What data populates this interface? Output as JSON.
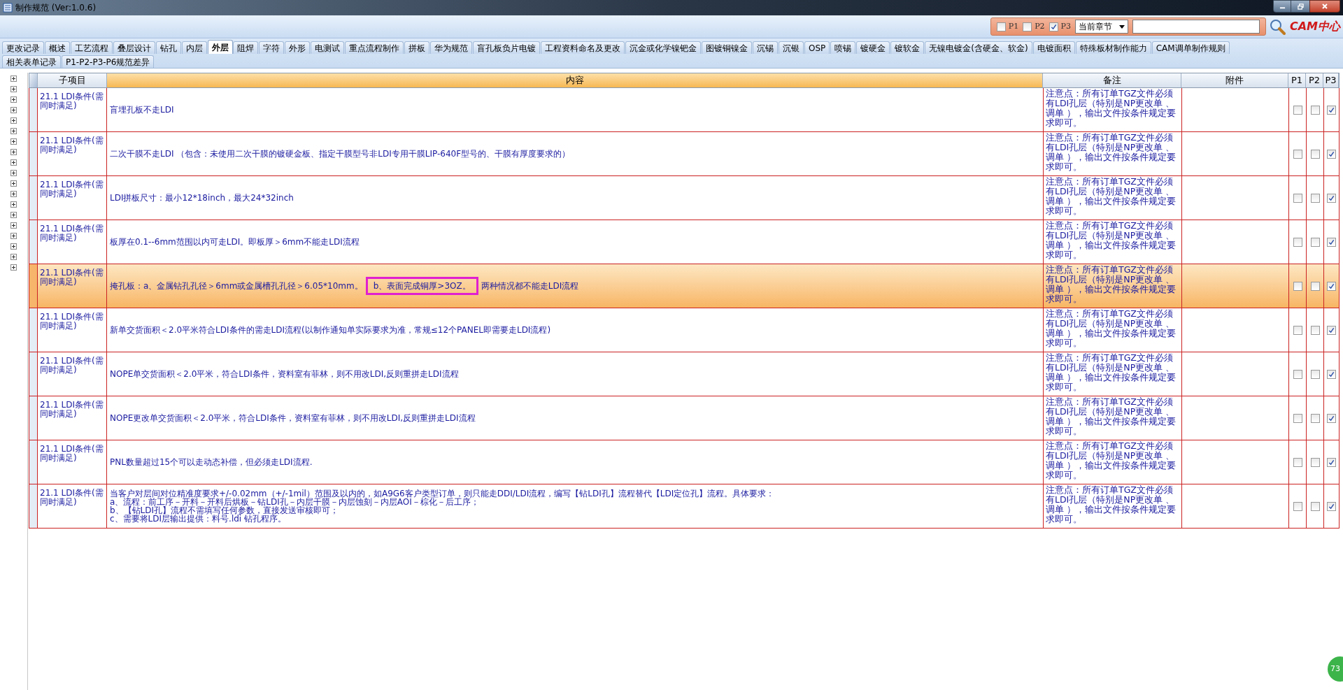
{
  "window": {
    "title": "制作规范 (Ver:1.0.6)"
  },
  "toolbar": {
    "filters": [
      {
        "label": "P1",
        "checked": false
      },
      {
        "label": "P2",
        "checked": false
      },
      {
        "label": "P3",
        "checked": true
      }
    ],
    "scope": "当前章节",
    "logo": "CAM中心"
  },
  "tab_rows": [
    [
      {
        "label": "更改记录",
        "selected": false
      },
      {
        "label": "概述",
        "selected": false
      },
      {
        "label": "工艺流程",
        "selected": false
      },
      {
        "label": "叠层设计",
        "selected": false
      },
      {
        "label": "钻孔",
        "selected": false
      },
      {
        "label": "内层",
        "selected": false
      },
      {
        "label": "外层",
        "selected": true
      },
      {
        "label": "阻焊",
        "selected": false
      },
      {
        "label": "字符",
        "selected": false
      },
      {
        "label": "外形",
        "selected": false
      },
      {
        "label": "电测试",
        "selected": false
      },
      {
        "label": "重点流程制作",
        "selected": false
      },
      {
        "label": "拼板",
        "selected": false
      },
      {
        "label": "华为规范",
        "selected": false
      },
      {
        "label": "盲孔板负片电镀",
        "selected": false
      },
      {
        "label": "工程资料命名及更改",
        "selected": false
      },
      {
        "label": "沉金或化学镍钯金",
        "selected": false
      },
      {
        "label": "图镀铜镍金",
        "selected": false
      },
      {
        "label": "沉锡",
        "selected": false
      },
      {
        "label": "沉银",
        "selected": false
      },
      {
        "label": "OSP",
        "selected": false
      },
      {
        "label": "喷锡",
        "selected": false
      },
      {
        "label": "镀硬金",
        "selected": false
      },
      {
        "label": "镀软金",
        "selected": false
      },
      {
        "label": "无镍电镀金(含硬金、软金)",
        "selected": false
      },
      {
        "label": "电镀面积",
        "selected": false
      },
      {
        "label": "特殊板材制作能力",
        "selected": false
      },
      {
        "label": "CAM调单制作规则",
        "selected": false
      }
    ],
    [
      {
        "label": "相关表单记录",
        "selected": false
      },
      {
        "label": "P1-P2-P3-P6规范差异",
        "selected": false
      }
    ]
  ],
  "tree_nodes": [
    {
      "expanded": false
    },
    {
      "expanded": false
    },
    {
      "expanded": false
    },
    {
      "expanded": false
    },
    {
      "expanded": false
    },
    {
      "expanded": false
    },
    {
      "expanded": false
    },
    {
      "expanded": false
    },
    {
      "expanded": false
    },
    {
      "expanded": false
    },
    {
      "expanded": false
    },
    {
      "expanded": false
    },
    {
      "expanded": false
    },
    {
      "expanded": false
    },
    {
      "expanded": false
    },
    {
      "expanded": false
    },
    {
      "expanded": false
    },
    {
      "expanded": false
    },
    {
      "expanded": false
    }
  ],
  "table": {
    "columns": [
      "子项目",
      "内容",
      "备注",
      "附件",
      "P1",
      "P2",
      "P3"
    ],
    "rows": [
      {
        "selected": false,
        "sub_item": "21.1 LDI条件(需同时满足)",
        "content": [
          {
            "text": "盲埋孔板不走LDI",
            "boxed": false
          }
        ],
        "note": "注意点：所有订单TGZ文件必须有LDI孔层（特别是NP更改单 、调单 ），输出文件按条件规定要求即可。",
        "p1": false,
        "p2": false,
        "p3": true
      },
      {
        "selected": false,
        "sub_item": "21.1 LDI条件(需同时满足)",
        "content": [
          {
            "text": "二次干膜不走LDI （包含：未使用二次干膜的镀硬金板、指定干膜型号非LDI专用干膜LIP-640F型号的、干膜有厚度要求的）",
            "boxed": false
          }
        ],
        "note": "注意点：所有订单TGZ文件必须有LDI孔层（特别是NP更改单 、调单 ），输出文件按条件规定要求即可。",
        "p1": false,
        "p2": false,
        "p3": true
      },
      {
        "selected": false,
        "sub_item": "21.1 LDI条件(需同时满足)",
        "content": [
          {
            "text": "LDI拼板尺寸：最小12*18inch，最大24*32inch",
            "boxed": false
          }
        ],
        "note": "注意点：所有订单TGZ文件必须有LDI孔层（特别是NP更改单 、调单 ），输出文件按条件规定要求即可。",
        "p1": false,
        "p2": false,
        "p3": true
      },
      {
        "selected": false,
        "sub_item": "21.1 LDI条件(需同时满足)",
        "content": [
          {
            "text": "板厚在0.1--6mm范围以内可走LDI。即板厚＞6mm不能走LDI流程",
            "boxed": false
          }
        ],
        "note": "注意点：所有订单TGZ文件必须有LDI孔层（特别是NP更改单 、调单 ），输出文件按条件规定要求即可。",
        "p1": false,
        "p2": false,
        "p3": true
      },
      {
        "selected": true,
        "sub_item": "21.1 LDI条件(需同时满足)",
        "content": [
          {
            "text": "掩孔板：a、金属钻孔孔径＞6mm或金属槽孔孔径＞6.05*10mm。",
            "boxed": false
          },
          {
            "text": "b、表面完成铜厚>3OZ。",
            "boxed": true
          },
          {
            "text": "两种情况都不能走LDI流程",
            "boxed": false
          }
        ],
        "note": "注意点：所有订单TGZ文件必须有LDI孔层（特别是NP更改单 、调单 ），输出文件按条件规定要求即可。",
        "p1": false,
        "p2": false,
        "p3": true
      },
      {
        "selected": false,
        "sub_item": "21.1 LDI条件(需同时满足)",
        "content": [
          {
            "text": "新单交货面积＜2.0平米符合LDI条件的需走LDI流程(以制作通知单实际要求为准，常规≤12个PANEL即需要走LDI流程)",
            "boxed": false
          }
        ],
        "note": "注意点：所有订单TGZ文件必须有LDI孔层（特别是NP更改单 、调单 ），输出文件按条件规定要求即可。",
        "p1": false,
        "p2": false,
        "p3": true
      },
      {
        "selected": false,
        "sub_item": "21.1 LDI条件(需同时满足)",
        "content": [
          {
            "text": "NOPE单交货面积＜2.0平米，符合LDI条件，资料室有菲林，则不用改LDI,反则重拼走LDI流程",
            "boxed": false
          }
        ],
        "note": "注意点：所有订单TGZ文件必须有LDI孔层（特别是NP更改单 、调单 ），输出文件按条件规定要求即可。",
        "p1": false,
        "p2": false,
        "p3": true
      },
      {
        "selected": false,
        "sub_item": "21.1 LDI条件(需同时满足)",
        "content": [
          {
            "text": "NOPE更改单交货面积＜2.0平米，符合LDI条件，资料室有菲林，则不用改LDI,反则重拼走LDI流程",
            "boxed": false
          }
        ],
        "note": "注意点：所有订单TGZ文件必须有LDI孔层（特别是NP更改单 、调单 ），输出文件按条件规定要求即可。",
        "p1": false,
        "p2": false,
        "p3": true
      },
      {
        "selected": false,
        "sub_item": "21.1 LDI条件(需同时满足)",
        "content": [
          {
            "text": "PNL数量超过15个可以走动态补偿，但必须走LDI流程.",
            "boxed": false
          }
        ],
        "note": "注意点：所有订单TGZ文件必须有LDI孔层（特别是NP更改单 、调单 ），输出文件按条件规定要求即可。",
        "p1": false,
        "p2": false,
        "p3": true
      },
      {
        "selected": false,
        "sub_item": "21.1 LDI条件(需同时满足)",
        "content": [
          {
            "text": "当客户对层间对位精准度要求+/-0.02mm（+/-1mil）范围及以内的，如A9G6客户类型订单，则只能走DDI/LDI流程，编写【钻LDI孔】流程替代【LDI定位孔】流程。具体要求：\na、流程：前工序－开料－开料后烘板－钻LDI孔－内层干膜－内层蚀刻－内层AOI－棕化－后工序；\nb、【钻LDI孔】流程不需填写任何参数，直接发送审核即可；\nc、需要将LDI层输出提供：料号.ldi 钻孔程序。",
            "boxed": false
          }
        ],
        "note": "注意点：所有订单TGZ文件必须有LDI孔层（特别是NP更改单 、调单 ），输出文件按条件规定要求即可。",
        "p1": false,
        "p2": false,
        "p3": true
      }
    ]
  },
  "corner_badge": "73"
}
